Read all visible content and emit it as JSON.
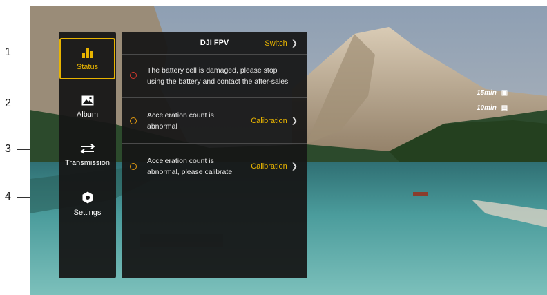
{
  "callouts": [
    "1",
    "2",
    "3",
    "4"
  ],
  "sidebar": {
    "items": [
      {
        "label": "Status",
        "icon": "bar-chart-icon",
        "active": true
      },
      {
        "label": "Album",
        "icon": "image-icon",
        "active": false
      },
      {
        "label": "Transmission",
        "icon": "transfer-arrows-icon",
        "active": false
      },
      {
        "label": "Settings",
        "icon": "hexagon-gear-icon",
        "active": false
      }
    ]
  },
  "panel": {
    "title": "DJI FPV",
    "switch_label": "Switch",
    "rows": [
      {
        "text_line1": "The battery cell is damaged, please stop",
        "text_line2": "using the battery and contact the after-sales",
        "severity": "error",
        "action": ""
      },
      {
        "text_line1": "Acceleration count is",
        "text_line2": "abnormal",
        "severity": "warning",
        "action": "Calibration"
      },
      {
        "text_line1": "Acceleration count is",
        "text_line2": "abnormal, please calibrate",
        "severity": "warning",
        "action": "Calibration"
      }
    ]
  },
  "osd": {
    "aircraft_time": "15min",
    "goggles_time": "10min"
  },
  "colors": {
    "accent": "#e8b400",
    "error": "#d83a2e",
    "warning": "#e39a10",
    "panel_bg": "#161616"
  }
}
